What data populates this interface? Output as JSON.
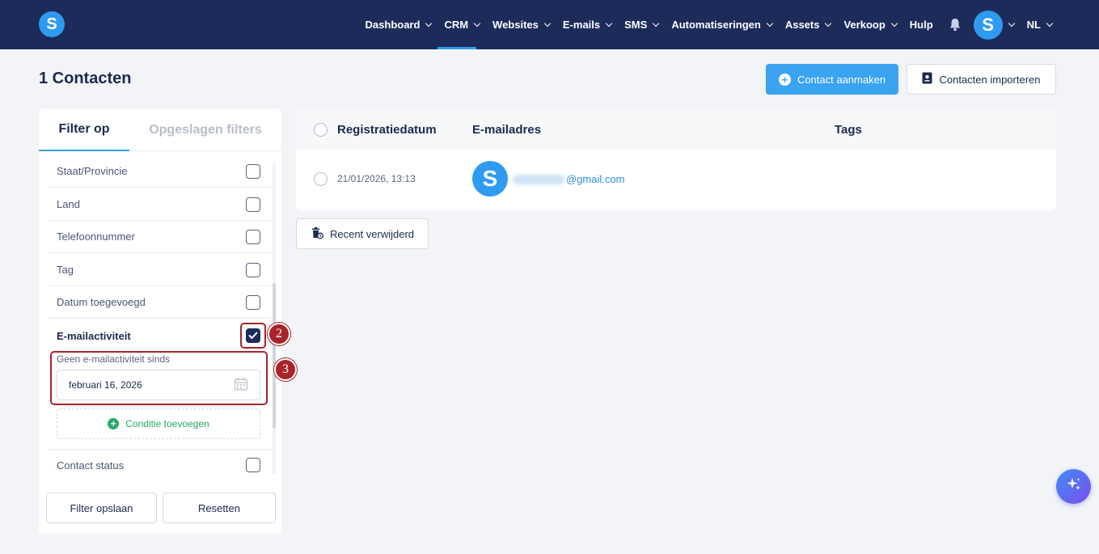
{
  "nav": {
    "logo_letter": "S",
    "items": [
      {
        "label": "Dashboard",
        "dropdown": true
      },
      {
        "label": "CRM",
        "dropdown": true,
        "active": true
      },
      {
        "label": "Websites",
        "dropdown": true
      },
      {
        "label": "E-mails",
        "dropdown": true
      },
      {
        "label": "SMS",
        "dropdown": true
      },
      {
        "label": "Automatiseringen",
        "dropdown": true
      },
      {
        "label": "Assets",
        "dropdown": true
      },
      {
        "label": "Verkoop",
        "dropdown": true
      },
      {
        "label": "Hulp",
        "dropdown": false
      }
    ],
    "avatar_letter": "S",
    "language": "NL",
    "colors": {
      "bar": "#1c2b5a",
      "accent": "#2e9bf0"
    }
  },
  "header": {
    "title": "1 Contacten",
    "create_button": "Contact aanmaken",
    "import_button": "Contacten importeren"
  },
  "filter_panel": {
    "tabs": [
      "Filter op",
      "Opgeslagen filters"
    ],
    "rows": [
      {
        "label": "Staat/Provincie",
        "checked": false
      },
      {
        "label": "Land",
        "checked": false
      },
      {
        "label": "Telefoonnummer",
        "checked": false
      },
      {
        "label": "Tag",
        "checked": false
      },
      {
        "label": "Datum toegevoegd",
        "checked": false
      },
      {
        "label": "E-mailactiviteit",
        "checked": true
      },
      {
        "label": "Contact status",
        "checked": false
      }
    ],
    "condition": {
      "label": "Geen e-mailactiviteit sinds",
      "date_value": "februari 16, 2026",
      "add_condition": "Conditie toevoegen"
    },
    "save_button": "Filter opslaan",
    "reset_button": "Resetten"
  },
  "table": {
    "columns": [
      "Registratiedatum",
      "E-mailadres",
      "Tags"
    ],
    "rows": [
      {
        "date": "21/01/2026, 13:13",
        "avatar_letter": "S",
        "email_visible": "@gmail.com"
      }
    ]
  },
  "recent_deleted_button": "Recent verwijderd",
  "annotations": {
    "marker_checkbox": "2",
    "marker_condition": "3",
    "color": "#a8232a"
  }
}
